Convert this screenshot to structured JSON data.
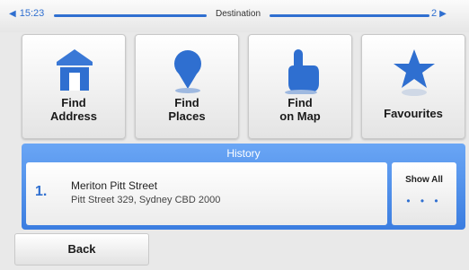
{
  "status": {
    "left_text": "15:23",
    "title": "Destination",
    "right_text": "2"
  },
  "tiles": [
    {
      "label": "Find\nAddress",
      "icon": "house-icon"
    },
    {
      "label": "Find\nPlaces",
      "icon": "map-pin-icon"
    },
    {
      "label": "Find\non Map",
      "icon": "hand-pointer-icon"
    },
    {
      "label": "Favourites",
      "icon": "star-icon"
    }
  ],
  "history": {
    "header": "History",
    "entry": {
      "number": "1.",
      "name": "Meriton Pitt Street",
      "address": "Pitt Street 329, Sydney CBD 2000"
    },
    "show_all": "Show All",
    "dots": "• • •"
  },
  "back": "Back",
  "colors": {
    "accent": "#2f6fd0",
    "panel": "#4a8ae8",
    "background": "#e9e9e9"
  }
}
